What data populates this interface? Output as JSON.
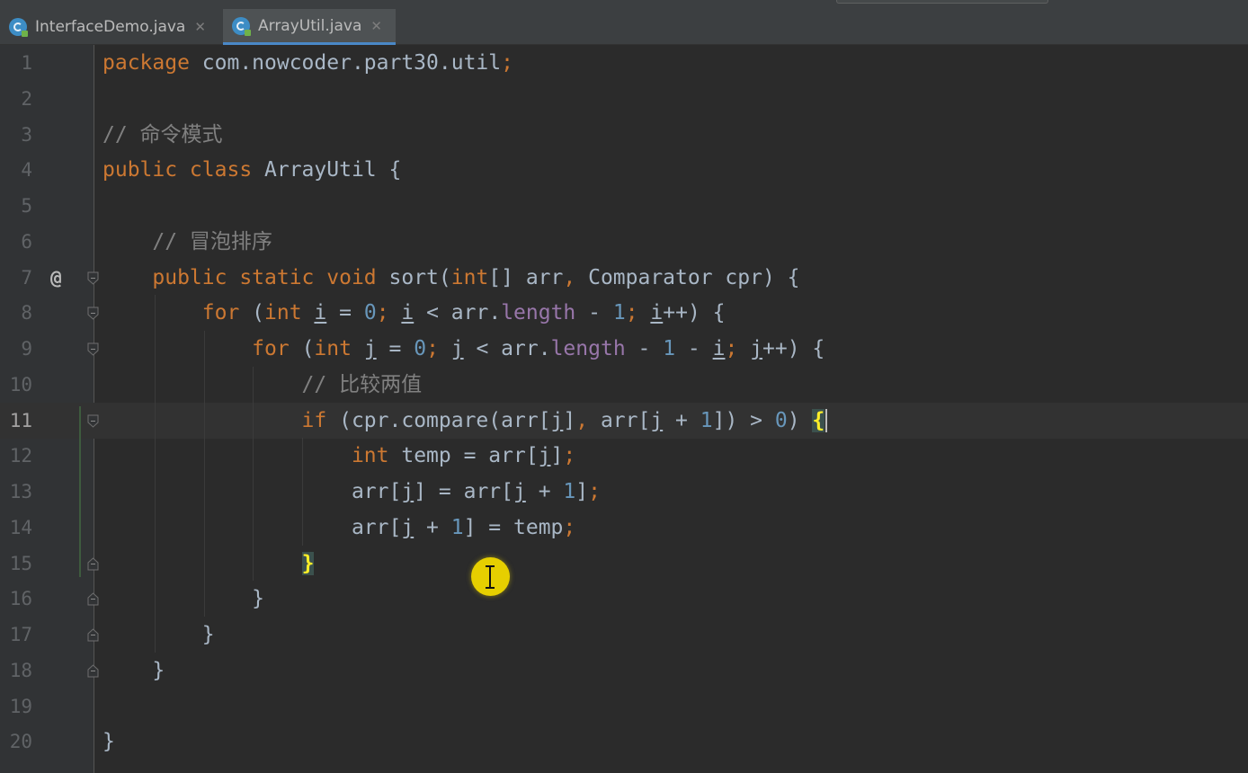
{
  "tabs": [
    {
      "label": "InterfaceDemo.java",
      "close_icon": "close-icon",
      "file_icon": "java-class-icon",
      "active": false
    },
    {
      "label": "ArrayUtil.java",
      "close_icon": "close-icon",
      "file_icon": "java-class-icon",
      "active": true
    }
  ],
  "editor": {
    "current_line": 11,
    "gutter_markers": {
      "7": "@"
    },
    "line_numbers": [
      "1",
      "2",
      "3",
      "4",
      "5",
      "6",
      "7",
      "8",
      "9",
      "10",
      "11",
      "12",
      "13",
      "14",
      "15",
      "16",
      "17",
      "18",
      "19",
      "20"
    ],
    "lines": [
      [
        {
          "t": "package ",
          "s": "k"
        },
        {
          "t": "com.nowcoder.part30.util",
          "s": "p"
        },
        {
          "t": ";",
          "s": "k"
        }
      ],
      [],
      [
        {
          "t": "// 命令模式",
          "s": "c"
        }
      ],
      [
        {
          "t": "public class ",
          "s": "k"
        },
        {
          "t": "ArrayUtil {",
          "s": "p"
        }
      ],
      [],
      [
        {
          "t": "    // 冒泡排序",
          "s": "c"
        }
      ],
      [
        {
          "t": "    public static void ",
          "s": "k"
        },
        {
          "t": "sort(",
          "s": "p"
        },
        {
          "t": "int",
          "s": "k"
        },
        {
          "t": "[] arr",
          "s": "p"
        },
        {
          "t": ", ",
          "s": "k"
        },
        {
          "t": "Comparator cpr) {",
          "s": "p"
        }
      ],
      [
        {
          "t": "        for ",
          "s": "k"
        },
        {
          "t": "(",
          "s": "p"
        },
        {
          "t": "int ",
          "s": "k"
        },
        {
          "t": "i",
          "s": "u"
        },
        {
          "t": " = ",
          "s": "p"
        },
        {
          "t": "0",
          "s": "n"
        },
        {
          "t": "; ",
          "s": "k"
        },
        {
          "t": "i",
          "s": "u"
        },
        {
          "t": " < arr.",
          "s": "p"
        },
        {
          "t": "length",
          "s": "f"
        },
        {
          "t": " - ",
          "s": "p"
        },
        {
          "t": "1",
          "s": "n"
        },
        {
          "t": "; ",
          "s": "k"
        },
        {
          "t": "i",
          "s": "u"
        },
        {
          "t": "++) {",
          "s": "p"
        }
      ],
      [
        {
          "t": "            for ",
          "s": "k"
        },
        {
          "t": "(",
          "s": "p"
        },
        {
          "t": "int ",
          "s": "k"
        },
        {
          "t": "j",
          "s": "u"
        },
        {
          "t": " = ",
          "s": "p"
        },
        {
          "t": "0",
          "s": "n"
        },
        {
          "t": "; ",
          "s": "k"
        },
        {
          "t": "j",
          "s": "u"
        },
        {
          "t": " < arr.",
          "s": "p"
        },
        {
          "t": "length",
          "s": "f"
        },
        {
          "t": " - ",
          "s": "p"
        },
        {
          "t": "1",
          "s": "n"
        },
        {
          "t": " - ",
          "s": "p"
        },
        {
          "t": "i",
          "s": "u"
        },
        {
          "t": "; ",
          "s": "k"
        },
        {
          "t": "j",
          "s": "u"
        },
        {
          "t": "++) {",
          "s": "p"
        }
      ],
      [
        {
          "t": "                // 比较两值",
          "s": "c"
        }
      ],
      [
        {
          "t": "                if ",
          "s": "k"
        },
        {
          "t": "(cpr.compare(arr[",
          "s": "p"
        },
        {
          "t": "j",
          "s": "u"
        },
        {
          "t": "]",
          "s": "p"
        },
        {
          "t": ", ",
          "s": "k"
        },
        {
          "t": "arr[",
          "s": "p"
        },
        {
          "t": "j",
          "s": "u"
        },
        {
          "t": " + ",
          "s": "p"
        },
        {
          "t": "1",
          "s": "n"
        },
        {
          "t": "]) > ",
          "s": "p"
        },
        {
          "t": "0",
          "s": "n"
        },
        {
          "t": ") ",
          "s": "p"
        },
        {
          "t": "{",
          "s": "bm"
        },
        {
          "t": "",
          "s": "caret"
        }
      ],
      [
        {
          "t": "                    int ",
          "s": "k"
        },
        {
          "t": "temp = arr[",
          "s": "p"
        },
        {
          "t": "j",
          "s": "u"
        },
        {
          "t": "]",
          "s": "p"
        },
        {
          "t": ";",
          "s": "k"
        }
      ],
      [
        {
          "t": "                    ",
          "s": "p"
        },
        {
          "t": "arr[",
          "s": "p"
        },
        {
          "t": "j",
          "s": "u"
        },
        {
          "t": "] = arr[",
          "s": "p"
        },
        {
          "t": "j",
          "s": "u"
        },
        {
          "t": " + ",
          "s": "p"
        },
        {
          "t": "1",
          "s": "n"
        },
        {
          "t": "]",
          "s": "p"
        },
        {
          "t": ";",
          "s": "k"
        }
      ],
      [
        {
          "t": "                    ",
          "s": "p"
        },
        {
          "t": "arr[",
          "s": "p"
        },
        {
          "t": "j",
          "s": "u"
        },
        {
          "t": " + ",
          "s": "p"
        },
        {
          "t": "1",
          "s": "n"
        },
        {
          "t": "] = temp",
          "s": "p"
        },
        {
          "t": ";",
          "s": "k"
        }
      ],
      [
        {
          "t": "                ",
          "s": "p"
        },
        {
          "t": "}",
          "s": "bm"
        }
      ],
      [
        {
          "t": "            }",
          "s": "p"
        }
      ],
      [
        {
          "t": "        }",
          "s": "p"
        }
      ],
      [
        {
          "t": "    }",
          "s": "p"
        }
      ],
      [],
      [
        {
          "t": "}",
          "s": "p"
        }
      ]
    ],
    "fold_markers": {
      "7": "open",
      "8": "open",
      "9": "open",
      "11": "open",
      "15": "close",
      "16": "close",
      "17": "close",
      "18": "close"
    }
  },
  "mouse_cursor_icon": "text-cursor-icon",
  "colors": {
    "background": "#2b2b2b",
    "keyword": "#cc7832",
    "comment": "#808080",
    "number": "#6897bb",
    "field": "#9876aa",
    "plain": "#a9b7c6",
    "brace_match": "#ffef28"
  }
}
